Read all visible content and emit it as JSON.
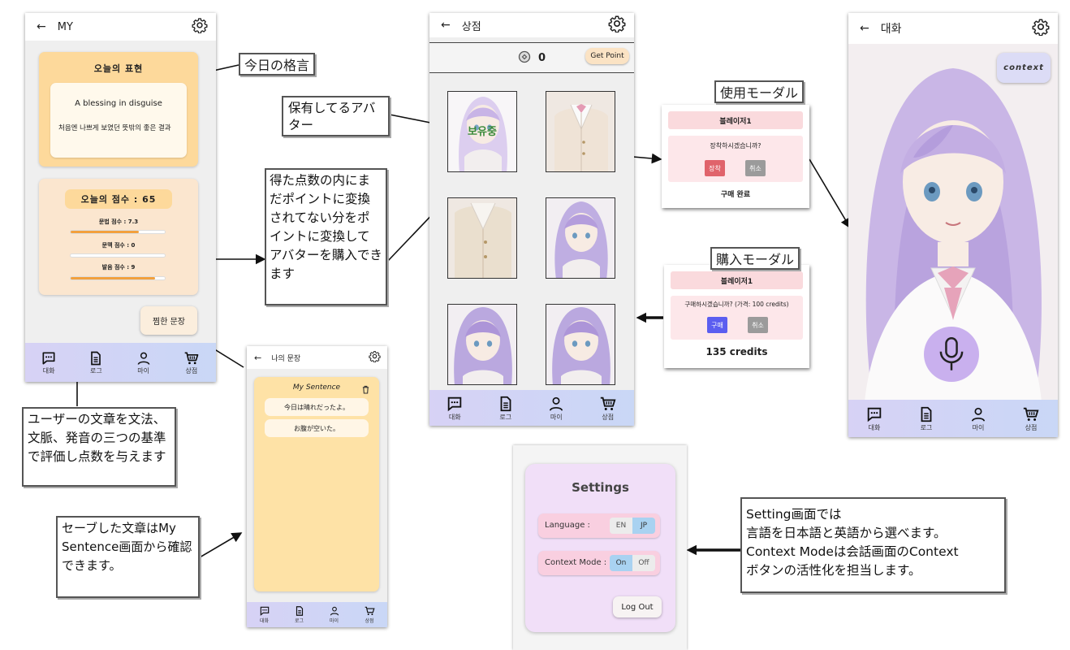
{
  "my_screen": {
    "title": "MY",
    "quote_card_title": "오늘의 표현",
    "quote_en": "A blessing in disguise",
    "quote_ko": "처음엔 나쁘게 보였던 뜻밖의 좋은 결과",
    "score_title": "오늘의 점수 : 65",
    "grammar_label": "문법 점수 : 7.3",
    "grammar_progress": 0.72,
    "context_label": "문맥 점수 : 0",
    "context_progress": 0.0,
    "pron_label": "발음 점수 : 9",
    "pron_progress": 0.9,
    "bookmark_button": "찜한 문장"
  },
  "nav": {
    "chat": "대화",
    "log": "로그",
    "my": "마이",
    "shop": "상점"
  },
  "shop_screen": {
    "title": "상점",
    "points": "0",
    "get_point_button": "Get Point",
    "owned_overlay": "보유중"
  },
  "sentence_screen": {
    "title": "나의 문장",
    "card_title": "My Sentence",
    "items": [
      "今日は晴れだったよ。",
      "お腹が空いた。"
    ]
  },
  "use_modal": {
    "header": "블레이저1",
    "question": "장착하시겠습니까?",
    "confirm": "장착",
    "cancel": "취소",
    "footer": "구매 완료"
  },
  "buy_modal": {
    "header": "블레이저1",
    "question": "구매하시겠습니까? (가격: 100 credits)",
    "confirm": "구매",
    "cancel": "취소",
    "footer": "135 credits"
  },
  "chat_screen": {
    "title": "대화",
    "context_button": "context"
  },
  "settings": {
    "title": "Settings",
    "language_label": "Language :",
    "lang_en": "EN",
    "lang_jp": "JP",
    "context_label": "Context Mode :",
    "ctx_on": "On",
    "ctx_off": "Off",
    "logout": "Log Out"
  },
  "annotations": {
    "motto": "今日の格言",
    "owned_avatar": "保有してるアバター",
    "points_note": "得た点数の内にまだポイントに変換されてない分をポイントに変換してアバターを購入できます",
    "use_modal": "使用モーダル",
    "buy_modal": "購入モーダル",
    "evaluation_note": "ユーザーの文章を文法、文脈、発音の三つの基準で評価し点数を与えます",
    "saved_note": "セーブした文章はMy Sentence画面から確認できます。",
    "settings_note_1": "Setting画面では",
    "settings_note_2": "言語を日本語と英語から選べます。",
    "settings_note_3": "Context Modeは会話画面のContext",
    "settings_note_4": "ボタンの活性化を担当します。"
  },
  "colors": {
    "nav_gradient_start": "#d7d2f5",
    "quote_card": "#fdd99b",
    "score_card": "#fbe6cf",
    "progress": "#f2a03d",
    "owned_text": "#3a8a3a",
    "buy_button": "#5b5ef0",
    "equip_button": "#e0636b",
    "settings_card": "#f1dff8"
  }
}
